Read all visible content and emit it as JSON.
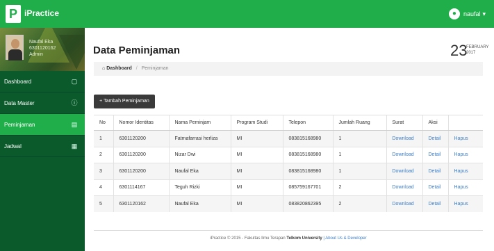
{
  "app": {
    "logo_letter": "P",
    "brand": "iPractice",
    "user_name": "naufal",
    "user_caret": "▾"
  },
  "profile": {
    "name": "Naufal Eka",
    "nim": "6301120162",
    "role": "Admin"
  },
  "sidebar": {
    "items": [
      {
        "label": "Dashboard",
        "icon": "▢"
      },
      {
        "label": "Data Master",
        "icon": "ⓘ"
      },
      {
        "label": "Peminjaman",
        "icon": "▤"
      },
      {
        "label": "Jadwal",
        "icon": "▦"
      }
    ]
  },
  "page": {
    "title": "Data Peminjaman",
    "date_day": "23",
    "date_month": "FEBRUARY",
    "date_year": "2017"
  },
  "breadcrumb": {
    "home_icon": "⌂",
    "home": "Dashboard",
    "sep": "/",
    "current": "Peminjaman"
  },
  "toolbar": {
    "add_label": "+ Tambah Peminjaman"
  },
  "table": {
    "headers": [
      "No",
      "Nomor Identitas",
      "Nama Peminjam",
      "Program Studi",
      "Telepon",
      "Jumlah Ruang",
      "Surat",
      "Aksi",
      ""
    ],
    "rows": [
      [
        "1",
        "6301120200",
        "Fatmafarrasi herliza",
        "MI",
        "083815168980",
        "1",
        "Download",
        "Detail",
        "Hapus"
      ],
      [
        "2",
        "6301120200",
        "Nizar Dwi",
        "MI",
        "083815168980",
        "1",
        "Download",
        "Detail",
        "Hapus"
      ],
      [
        "3",
        "6301120200",
        "Naufal Eka",
        "MI",
        "083815168980",
        "1",
        "Download",
        "Detail",
        "Hapus"
      ],
      [
        "4",
        "6301114167",
        "Teguh Rizki",
        "MI",
        "085759167701",
        "2",
        "Download",
        "Detail",
        "Hapus"
      ],
      [
        "5",
        "6301120162",
        "Naufal Eka",
        "MI",
        "083820862395",
        "2",
        "Download",
        "Detail",
        "Hapus"
      ]
    ]
  },
  "footer": {
    "prefix": "iPractice © 2015 - Fakultas Ilmu Terapan",
    "bold": "Telkom University",
    "links": "| About Us & Developer"
  },
  "colors": {
    "brand_green": "#1fae4a",
    "sidebar_dark": "#0a5a2b",
    "link_blue": "#3b7bc4"
  }
}
